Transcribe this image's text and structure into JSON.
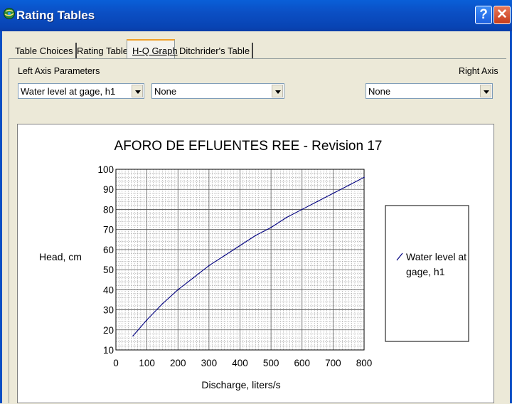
{
  "window": {
    "title": "Rating Tables",
    "help_label": "?",
    "close_label": "✕"
  },
  "tabs": [
    {
      "label": "Table Choices",
      "active": false
    },
    {
      "label": "Rating Table",
      "active": false
    },
    {
      "label": "H-Q Graph",
      "active": true
    },
    {
      "label": "Ditchrider's Table",
      "active": false
    }
  ],
  "params": {
    "left_label": "Left Axis Parameters",
    "right_label": "Right Axis",
    "left_primary": "Water level at gage, h1",
    "left_secondary": "None",
    "right_value": "None"
  },
  "chart_data": {
    "type": "line",
    "title": "AFORO DE EFLUENTES REE - Revision 17",
    "xlabel": "Discharge, liters/s",
    "ylabel": "Head, cm",
    "xlim": [
      0,
      800
    ],
    "ylim": [
      10,
      100
    ],
    "x_ticks": [
      "0",
      "100",
      "200",
      "300",
      "400",
      "500",
      "600",
      "700",
      "800"
    ],
    "y_ticks": [
      "10",
      "20",
      "30",
      "40",
      "50",
      "60",
      "70",
      "80",
      "90",
      "100"
    ],
    "grid": true,
    "legend_position": "right",
    "series": [
      {
        "name": "Water level at gage, h1",
        "color": "#00007f",
        "x": [
          55,
          100,
          150,
          200,
          250,
          300,
          350,
          400,
          450,
          500,
          550,
          600,
          650,
          700,
          750,
          800
        ],
        "y": [
          17,
          25,
          33,
          40,
          46,
          52,
          57,
          62,
          67,
          71,
          76,
          80,
          84,
          88,
          92,
          96
        ]
      }
    ]
  }
}
